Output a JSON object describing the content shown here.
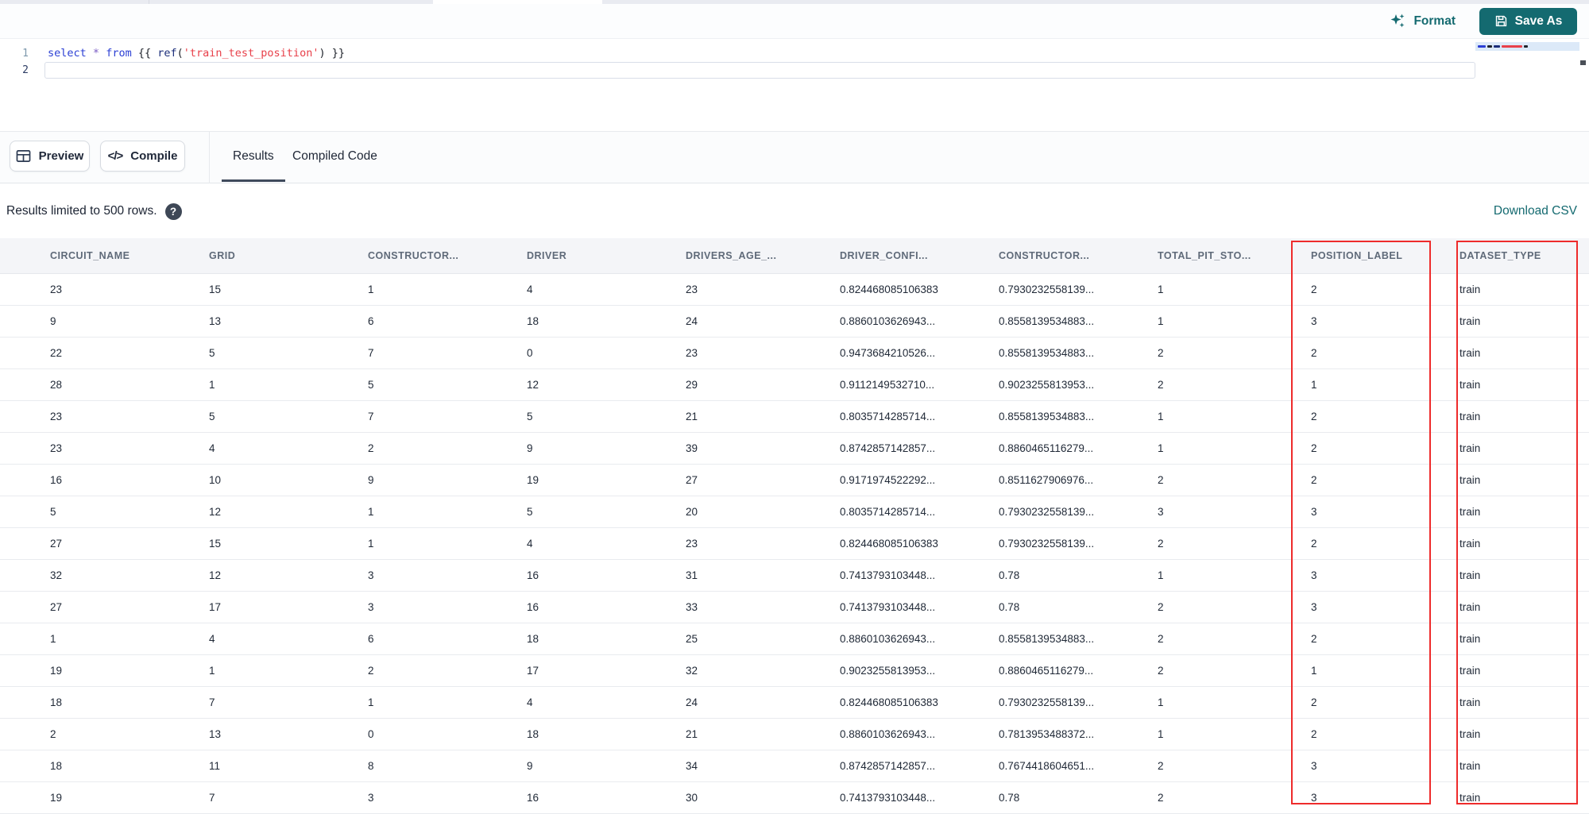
{
  "toolbar": {
    "format_label": "Format",
    "save_as_label": "Save As"
  },
  "editor": {
    "lines": [
      {
        "number": "1",
        "tokens": [
          [
            "select",
            "kw"
          ],
          [
            " ",
            "pl"
          ],
          [
            "*",
            "op"
          ],
          [
            " ",
            "pl"
          ],
          [
            "from",
            "kw"
          ],
          [
            " {{ ",
            "pl"
          ],
          [
            "ref",
            "fn"
          ],
          [
            "(",
            "pl"
          ],
          [
            "'train_test_position'",
            "str"
          ],
          [
            ") }}",
            "pl"
          ]
        ]
      },
      {
        "number": "2",
        "tokens": []
      }
    ]
  },
  "actions": {
    "preview_label": "Preview",
    "compile_label": "Compile",
    "compile_icon_glyph": "</>"
  },
  "tabs": [
    {
      "label": "Results",
      "active": true
    },
    {
      "label": "Compiled Code",
      "active": false
    }
  ],
  "results_bar": {
    "notice": "Results limited to 500 rows.",
    "help_icon_glyph": "?",
    "download_label": "Download CSV"
  },
  "table": {
    "columns": [
      {
        "label": "CIRCUIT_NAME",
        "highlighted": false
      },
      {
        "label": "GRID",
        "highlighted": false
      },
      {
        "label": "CONSTRUCTOR...",
        "highlighted": false
      },
      {
        "label": "DRIVER",
        "highlighted": false
      },
      {
        "label": "DRIVERS_AGE_...",
        "highlighted": false
      },
      {
        "label": "DRIVER_CONFI...",
        "highlighted": false
      },
      {
        "label": "CONSTRUCTOR...",
        "highlighted": false
      },
      {
        "label": "TOTAL_PIT_STO...",
        "highlighted": false
      },
      {
        "label": "POSITION_LABEL",
        "highlighted": true
      },
      {
        "label": "DATASET_TYPE",
        "highlighted": true
      }
    ],
    "rows": [
      [
        "23",
        "15",
        "1",
        "4",
        "23",
        "0.824468085106383",
        "0.7930232558139...",
        "1",
        "2",
        "train"
      ],
      [
        "9",
        "13",
        "6",
        "18",
        "24",
        "0.8860103626943...",
        "0.8558139534883...",
        "1",
        "3",
        "train"
      ],
      [
        "22",
        "5",
        "7",
        "0",
        "23",
        "0.9473684210526...",
        "0.8558139534883...",
        "2",
        "2",
        "train"
      ],
      [
        "28",
        "1",
        "5",
        "12",
        "29",
        "0.9112149532710...",
        "0.9023255813953...",
        "2",
        "1",
        "train"
      ],
      [
        "23",
        "5",
        "7",
        "5",
        "21",
        "0.8035714285714...",
        "0.8558139534883...",
        "1",
        "2",
        "train"
      ],
      [
        "23",
        "4",
        "2",
        "9",
        "39",
        "0.8742857142857...",
        "0.8860465116279...",
        "1",
        "2",
        "train"
      ],
      [
        "16",
        "10",
        "9",
        "19",
        "27",
        "0.9171974522292...",
        "0.8511627906976...",
        "2",
        "2",
        "train"
      ],
      [
        "5",
        "12",
        "1",
        "5",
        "20",
        "0.8035714285714...",
        "0.7930232558139...",
        "3",
        "3",
        "train"
      ],
      [
        "27",
        "15",
        "1",
        "4",
        "23",
        "0.824468085106383",
        "0.7930232558139...",
        "2",
        "2",
        "train"
      ],
      [
        "32",
        "12",
        "3",
        "16",
        "31",
        "0.7413793103448...",
        "0.78",
        "1",
        "3",
        "train"
      ],
      [
        "27",
        "17",
        "3",
        "16",
        "33",
        "0.7413793103448...",
        "0.78",
        "2",
        "3",
        "train"
      ],
      [
        "1",
        "4",
        "6",
        "18",
        "25",
        "0.8860103626943...",
        "0.8558139534883...",
        "2",
        "2",
        "train"
      ],
      [
        "19",
        "1",
        "2",
        "17",
        "32",
        "0.9023255813953...",
        "0.8860465116279...",
        "2",
        "1",
        "train"
      ],
      [
        "18",
        "7",
        "1",
        "4",
        "24",
        "0.824468085106383",
        "0.7930232558139...",
        "1",
        "2",
        "train"
      ],
      [
        "2",
        "13",
        "0",
        "18",
        "21",
        "0.8860103626943...",
        "0.7813953488372...",
        "1",
        "2",
        "train"
      ],
      [
        "18",
        "11",
        "8",
        "9",
        "34",
        "0.8742857142857...",
        "0.7674418604651...",
        "2",
        "3",
        "train"
      ],
      [
        "19",
        "7",
        "3",
        "16",
        "30",
        "0.7413793103448...",
        "0.78",
        "2",
        "3",
        "train"
      ]
    ]
  },
  "colors": {
    "accent_teal": "#146a70",
    "highlight_red": "#ee2b2b",
    "tab_underline": "#3f4a5c",
    "code_keyword": "#2b3fd4",
    "code_string": "#e8404a",
    "code_operator": "#7a5cc4",
    "code_function": "#1b2d7a"
  }
}
